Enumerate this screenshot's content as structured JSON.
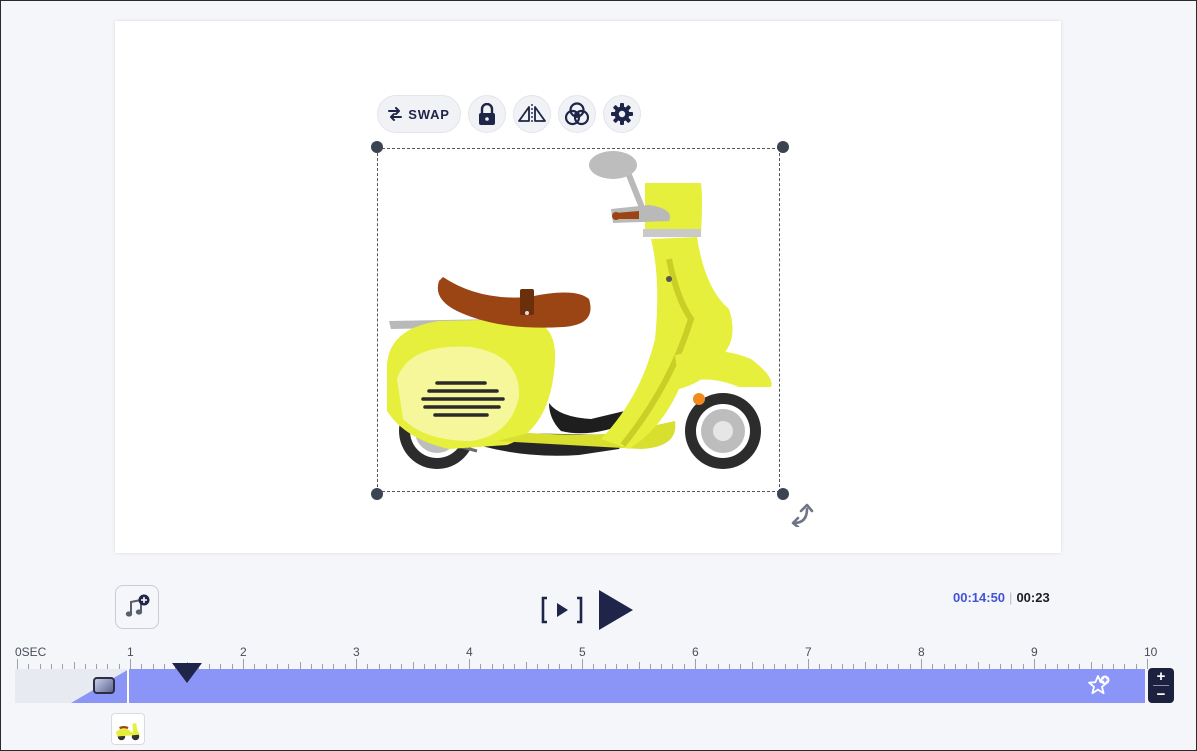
{
  "toolbar": {
    "swap_label": "SWAP",
    "icons": [
      "swap-icon",
      "lock-icon",
      "flip-icon",
      "color-filter-icon",
      "gear-icon"
    ]
  },
  "player": {
    "current_time": "00:14:50",
    "total_time": "00:23"
  },
  "timeline": {
    "ticks": [
      "0SEC",
      "1",
      "2",
      "3",
      "4",
      "5",
      "6",
      "7",
      "8",
      "9",
      "10"
    ],
    "playhead_seconds": 1.5,
    "zoom_in_label": "+",
    "zoom_out_label": "−"
  },
  "colors": {
    "accent_blue": "#4353d6",
    "track_fill": "#8b95f8",
    "dark_navy": "#1f2548",
    "scooter_yellow": "#e6ef3c",
    "seat_brown": "#9b4414"
  }
}
